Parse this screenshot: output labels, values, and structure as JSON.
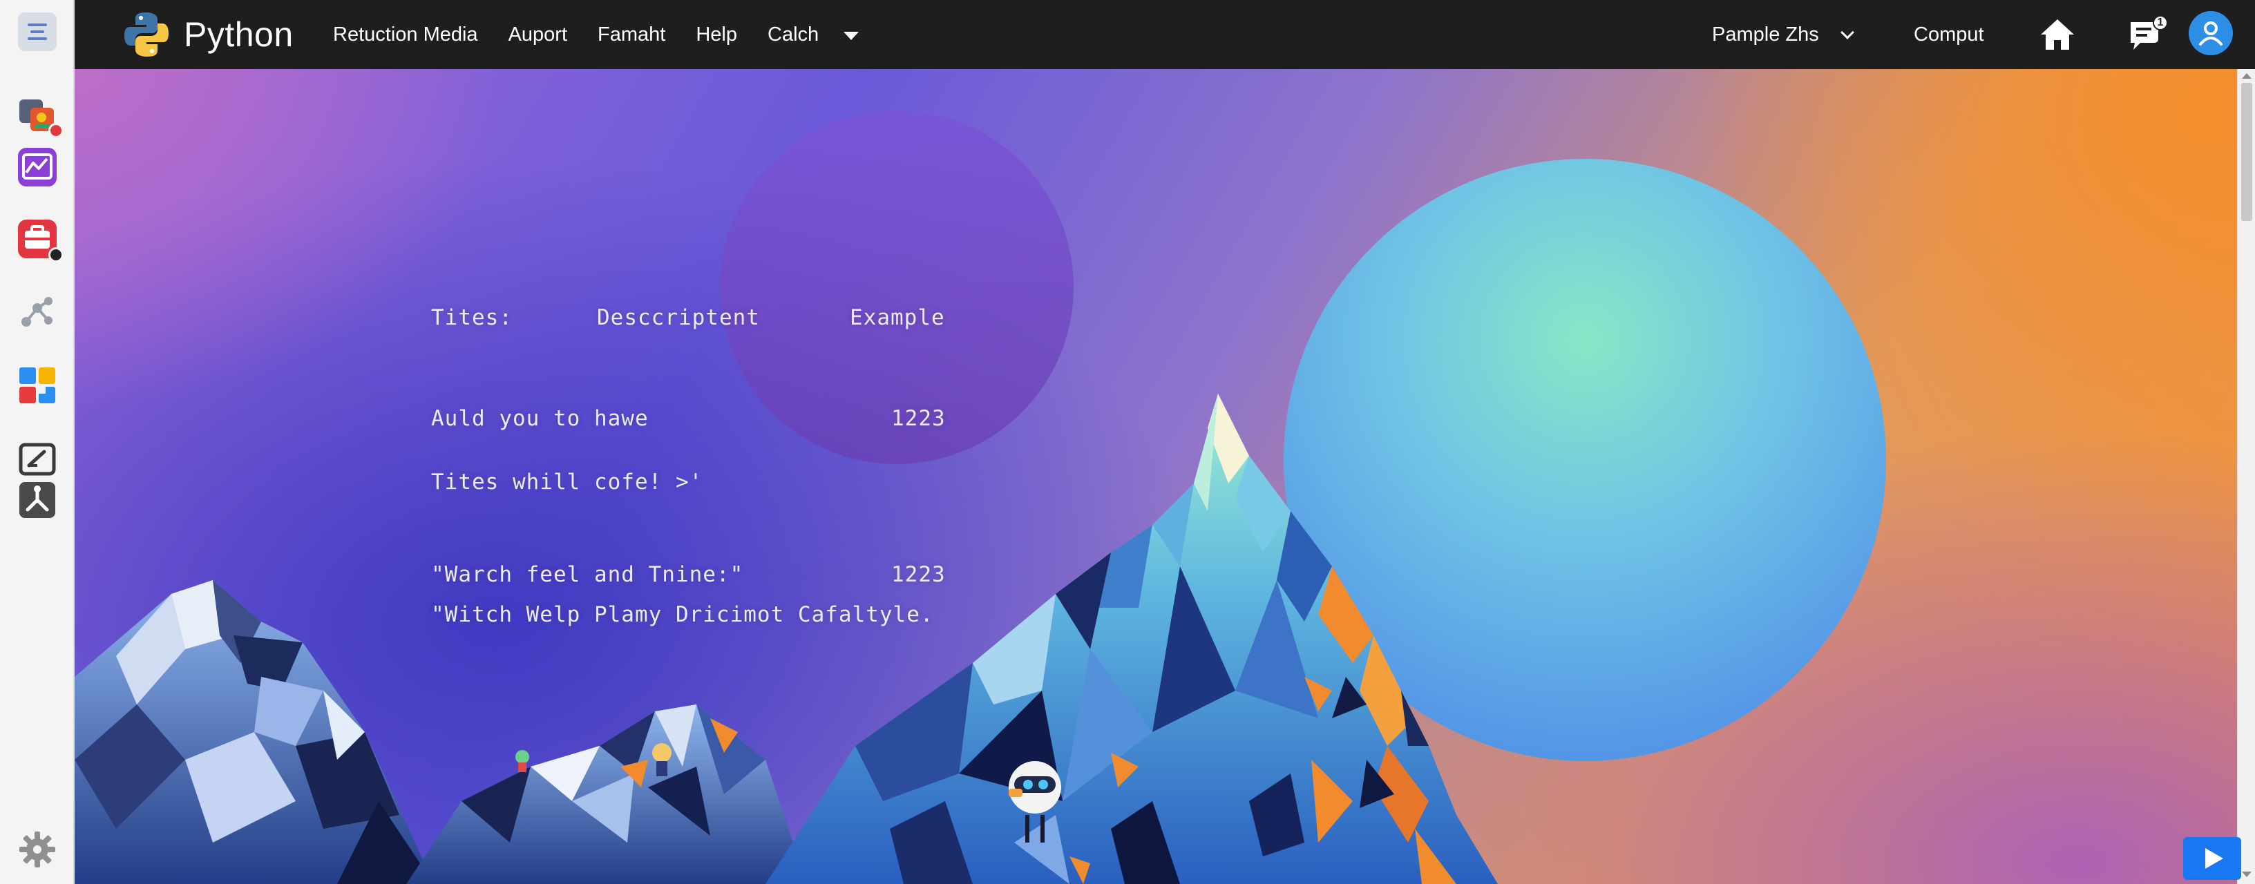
{
  "brand": {
    "name": "Python",
    "icon": "python-logo-icon"
  },
  "nav": {
    "items": [
      "Retuction Media",
      "Auport",
      "Famaht",
      "Help",
      "Calch"
    ],
    "more_icon": "caret-down-icon"
  },
  "user_menu": {
    "label": "Pample Zhs",
    "icon": "chevron-down-icon"
  },
  "right_link": "Comput",
  "notifications": {
    "count": "1"
  },
  "dock": {
    "items": [
      "app-menu-icon",
      "photo-app-icon",
      "chart-app-icon",
      "briefcase-app-icon",
      "network-app-icon",
      "tiles-app-icon",
      "edit-app-icon",
      "tool-app-icon",
      "settings-gear-icon"
    ]
  },
  "hero": {
    "header_titles": "Tites:",
    "header_description": "Desccriptent",
    "header_example": "Example",
    "row1_text": "Auld you to hawe",
    "row1_value": "1223",
    "row2_text": "Tites whill cofe! >'",
    "row3_text": "\"Warch feel and Tnine:\"",
    "row3_value": "1223",
    "row4_text": "\"Witch Welp Plamy Dricimot Cafaltyle."
  },
  "colors": {
    "topbar": "#1e1e1e",
    "accent_blue": "#1877f2",
    "avatar_blue": "#2d8ee6",
    "gradient_purple": "#9a68d8",
    "gradient_orange": "#f3953a"
  }
}
